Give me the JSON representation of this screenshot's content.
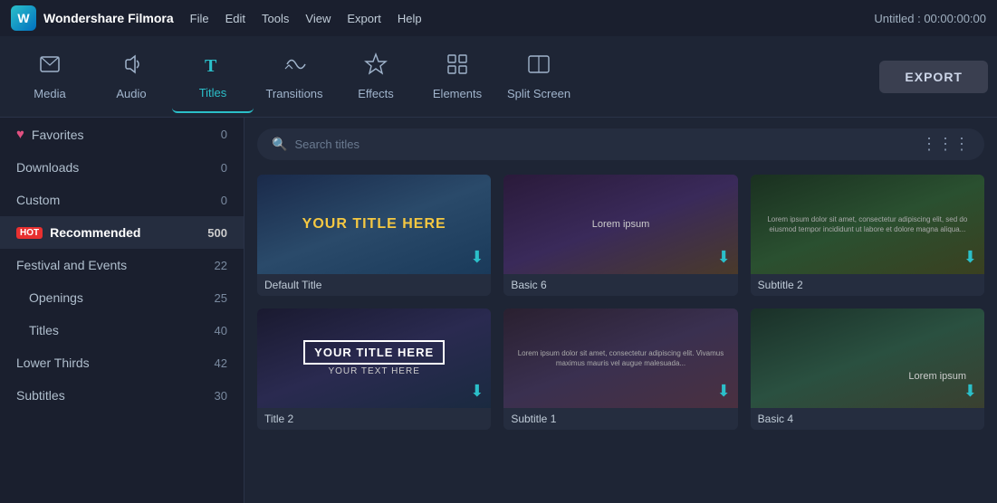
{
  "app": {
    "name": "Wondershare Filmora",
    "title_bar": "Untitled : 00:00:00:00"
  },
  "menu": {
    "items": [
      "File",
      "Edit",
      "Tools",
      "View",
      "Export",
      "Help"
    ]
  },
  "toolbar": {
    "items": [
      {
        "id": "media",
        "label": "Media",
        "icon": "⬜"
      },
      {
        "id": "audio",
        "label": "Audio",
        "icon": "♪"
      },
      {
        "id": "titles",
        "label": "Titles",
        "icon": "T",
        "active": true
      },
      {
        "id": "transitions",
        "label": "Transitions",
        "icon": "⟲"
      },
      {
        "id": "effects",
        "label": "Effects",
        "icon": "✦"
      },
      {
        "id": "elements",
        "label": "Elements",
        "icon": "❖"
      },
      {
        "id": "split-screen",
        "label": "Split Screen",
        "icon": "▣"
      }
    ],
    "export_label": "EXPORT"
  },
  "sidebar": {
    "items": [
      {
        "id": "favorites",
        "label": "Favorites",
        "count": "0",
        "icon": "♥"
      },
      {
        "id": "downloads",
        "label": "Downloads",
        "count": "0"
      },
      {
        "id": "custom",
        "label": "Custom",
        "count": "0"
      },
      {
        "id": "recommended",
        "label": "Recommended",
        "count": "500",
        "hot": true,
        "active": true
      },
      {
        "id": "festival-events",
        "label": "Festival and Events",
        "count": "22"
      },
      {
        "id": "openings",
        "label": "Openings",
        "count": "25"
      },
      {
        "id": "titles",
        "label": "Titles",
        "count": "40"
      },
      {
        "id": "lower-thirds",
        "label": "Lower Thirds",
        "count": "42"
      },
      {
        "id": "subtitles",
        "label": "Subtitles",
        "count": "30"
      }
    ]
  },
  "search": {
    "placeholder": "Search titles"
  },
  "grid": {
    "cards": [
      {
        "id": "default-title",
        "label": "Default Title",
        "text": "YOUR TITLE HERE",
        "text_style": "yellow",
        "bg": "card-bg-1"
      },
      {
        "id": "basic-6",
        "label": "Basic 6",
        "text": "Lorem ipsum",
        "text_style": "white-center",
        "bg": "card-bg-2"
      },
      {
        "id": "subtitle-2",
        "label": "Subtitle 2",
        "text": "Lorem ipsum dolor sit amet, consectetur adipiscing elit, sed do eiusmod...",
        "text_style": "small",
        "bg": "card-bg-3"
      },
      {
        "id": "title-2",
        "label": "Title 2",
        "text": "YOUR TITLE HERE",
        "text_style": "bordered",
        "subtext": "YOUR TEXT HERE",
        "bg": "card-bg-4"
      },
      {
        "id": "subtitle-1",
        "label": "Subtitle 1",
        "text": "Lorem ipsum dolor sit amet, consectetur adipiscing elit. Vivamus maximus mauris...",
        "text_style": "small",
        "bg": "card-bg-5"
      },
      {
        "id": "basic-4",
        "label": "Basic 4",
        "text": "Lorem ipsum",
        "text_style": "white-right",
        "bg": "card-bg-6"
      }
    ]
  }
}
